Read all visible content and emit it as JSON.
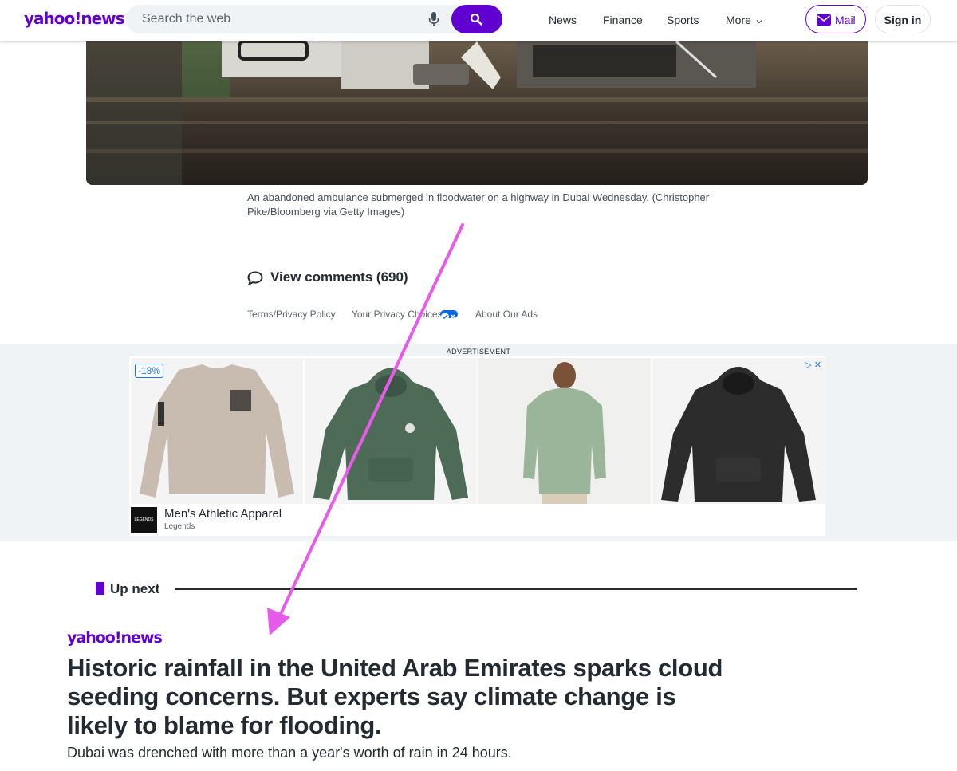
{
  "header": {
    "logo_text": "yahoo!news",
    "search_placeholder": "Search the web",
    "nav": [
      "News",
      "Finance",
      "Sports",
      "More"
    ],
    "mail_label": "Mail",
    "signin_label": "Sign in"
  },
  "article": {
    "caption_line1": "An abandoned ambulance submerged in floodwater on a highway in Dubai Wednesday. (Christopher",
    "caption_line2": "Pike/Bloomberg via Getty Images)",
    "comments_label": "View comments (690)"
  },
  "footer_links": {
    "terms": "Terms/Privacy Policy",
    "privacy_choices": "Your Privacy Choices",
    "about_ads": "About Our Ads"
  },
  "ad": {
    "label": "ADVERTISEMENT",
    "discount": "-18%",
    "title": "Men's Athletic Apparel",
    "brand": "Legends",
    "brand_logo_text": "LEGENDS",
    "adchoices": "▷ ✕",
    "product_colors": [
      "#c8bcb1",
      "#4e6b58",
      "#9bb59a",
      "#2c2c2c"
    ]
  },
  "up_next": {
    "label": "Up next",
    "logo_text": "yahoo!news",
    "headline": "Historic rainfall in the United Arab Emirates sparks cloud seeding concerns. But experts say climate change is likely to blame for flooding.",
    "summary": "Dubai was drenched with more than a year's worth of rain in 24 hours."
  },
  "colors": {
    "brand": "#6001d2",
    "annotation_arrow": "#e65ce8"
  }
}
